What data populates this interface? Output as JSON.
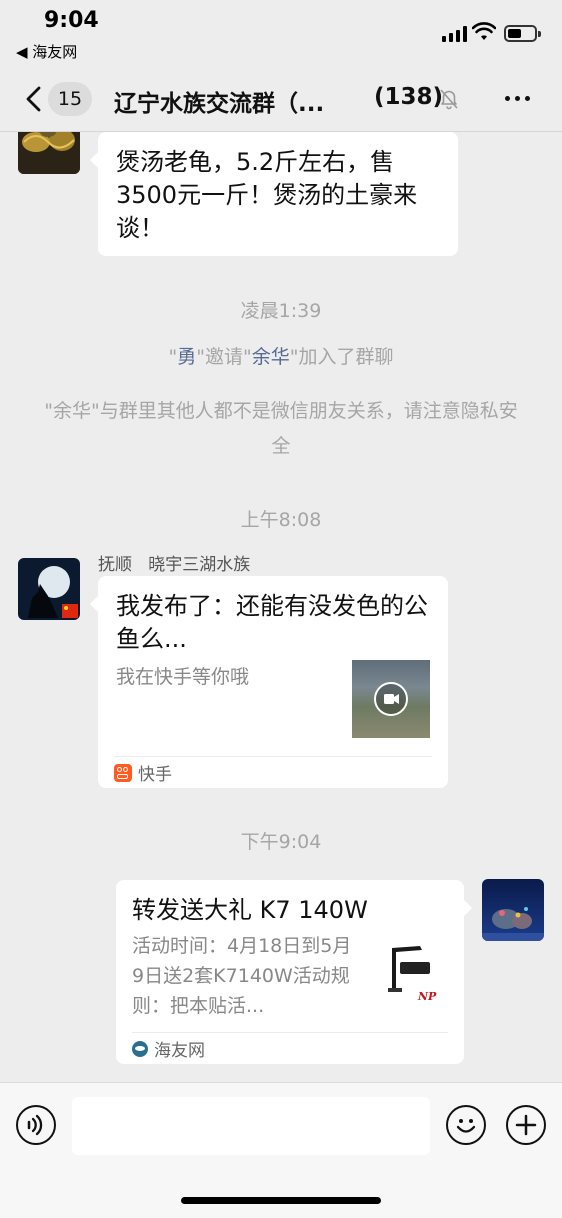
{
  "status_bar": {
    "time": "9:04",
    "back_app": "◀ 海友网"
  },
  "nav": {
    "unread_count": "15",
    "title": "辽宁水族交流群（...",
    "member_count": "(138)",
    "icons": [
      "back-chevron-icon",
      "mute-bell-icon",
      "more-icon"
    ]
  },
  "messages": {
    "msg1": {
      "text": "煲汤老龟，5.2斤左右，售3500元一斤！煲汤的土豪来谈！"
    },
    "ts1": "凌晨1:39",
    "sys1": {
      "q1": "\"",
      "inviter": "勇",
      "mid": "\"邀请\"",
      "invitee": "余华",
      "tail": "\"加入了群聊"
    },
    "sys2": "\"余华\"与群里其他人都不是微信朋友关系，请注意隐私安全",
    "ts2": "上午8:08",
    "msg2": {
      "sender": "抚顺   晓宇三湖水族",
      "title": "我发布了：还能有没发色的公鱼么...",
      "desc": "我在快手等你哦",
      "source": "快手",
      "source_color": "#ff5a1f"
    },
    "ts3": "下午9:04",
    "msg3": {
      "title": "转发送大礼 K7 140W",
      "desc": "活动时间：4月18日到5月9日送2套K7140W活动规则：把本贴活...",
      "source": "海友网",
      "thumb_label": "NP"
    }
  },
  "input_bar": {
    "placeholder": "",
    "icons": [
      "voice-icon",
      "emoji-icon",
      "plus-icon"
    ]
  }
}
